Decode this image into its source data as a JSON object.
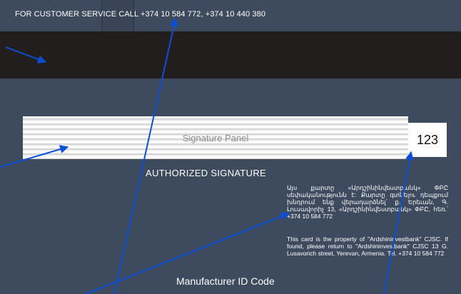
{
  "card_back": {
    "customer_service": "FOR CUSTOMER SERVICE CALL +374 10 584 772, +374 10 440 380",
    "signature_panel_label": "Signature Panel",
    "cvv": "123",
    "authorized_signature": "AUTHORIZED SIGNATURE",
    "notice_armenian": "Այս քարտը «Արդշինինվեստբանկ» ՓԲԸ սեփականությունն է: Քարտը գտնելու դեպքում խնդրում ենք վերադարձնել՝ ք. Երեւան, Գ. Լուսավորիչ 13, «Արդշինինվեստբանկ» ՓԲԸ, հեռ.՝ +374 10 584 772",
    "notice_english": "This card is the property of \"Ardshininvestbank\" CJSC. If found, please return to \"Ardshininvestbank\" CJSC 13 G. Lusavorich street, Yerevan, Armenia. Tel. +374 10 584 772",
    "manufacturer_id": "Manufacturer ID Code"
  },
  "colors": {
    "card_body": "#3e4b5e",
    "magnetic_stripe": "#221e1e",
    "annotation_arrows": "#0b4fd8"
  }
}
